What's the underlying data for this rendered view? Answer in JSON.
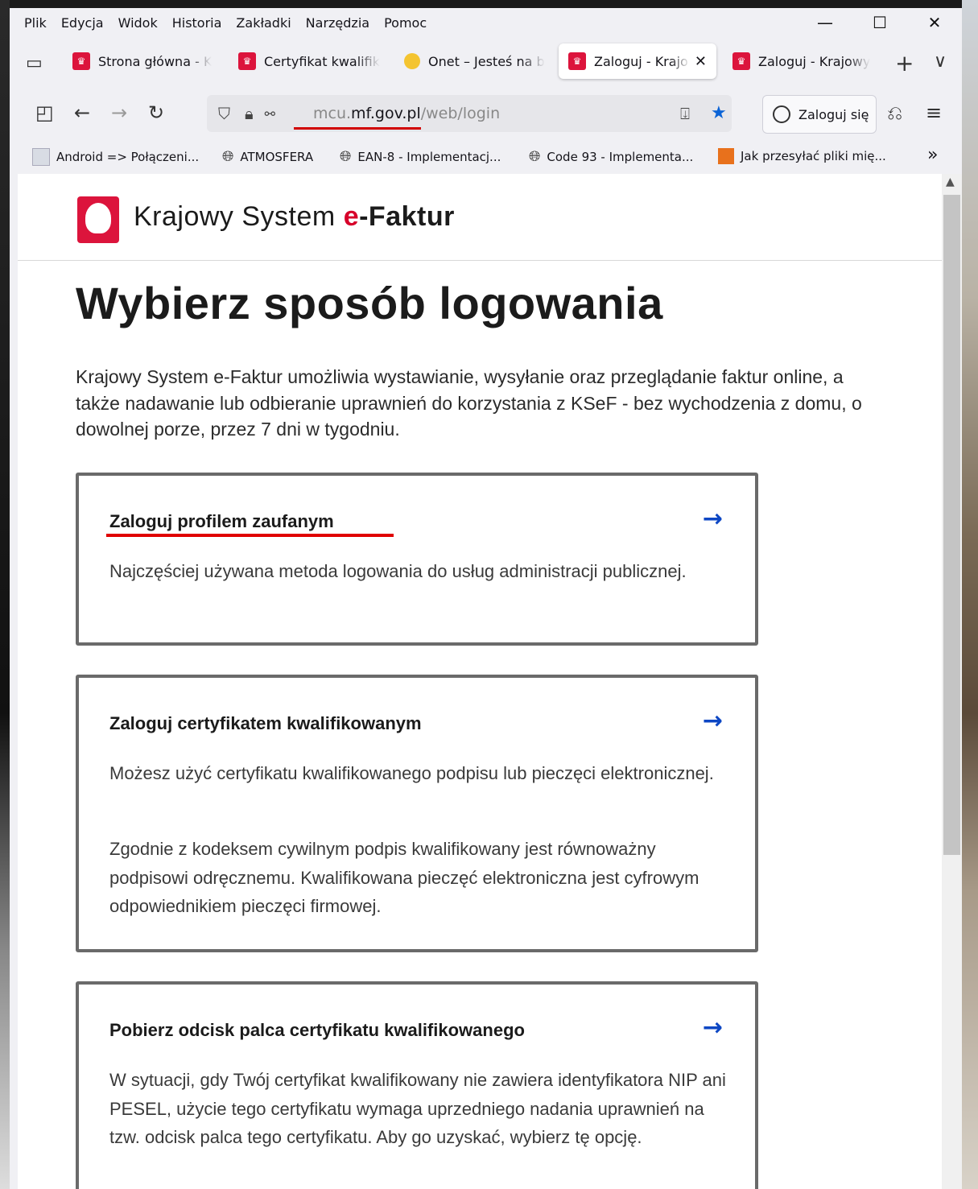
{
  "menu": [
    "Plik",
    "Edycja",
    "Widok",
    "Historia",
    "Zakładki",
    "Narzędzia",
    "Pomoc"
  ],
  "window_controls": {
    "minimize": "—",
    "maximize": "☐",
    "close": "✕"
  },
  "tabs": [
    {
      "label": "Strona główna - K",
      "favicon": "eagle-favicon"
    },
    {
      "label": "Certyfikat kwalifik",
      "favicon": "eagle-favicon"
    },
    {
      "label": "Onet – Jesteś na b",
      "favicon": "onet-favicon"
    },
    {
      "label": "Zaloguj - Krajo",
      "favicon": "eagle-favicon",
      "active": true
    },
    {
      "label": "Zaloguj - Krajowy",
      "favicon": "eagle-favicon"
    }
  ],
  "tab_close": "✕",
  "new_tab": "+",
  "tab_list": "∨",
  "url": {
    "prefix": "mcu.",
    "domain": "mf.gov.pl",
    "path": "/web/login"
  },
  "signin_label": "Zaloguj się",
  "bookmarks": [
    {
      "label": "Android => Połączeni...",
      "icon": "page-icon"
    },
    {
      "label": "ATMOSFERA",
      "icon": "globe-icon"
    },
    {
      "label": "EAN-8 - Implementacj...",
      "icon": "globe-icon"
    },
    {
      "label": "Code 93 - Implementa...",
      "icon": "globe-icon"
    },
    {
      "label": "Jak przesyłać pliki mię...",
      "icon": "stackoverflow-icon"
    }
  ],
  "bookmarks_more": "»",
  "site": {
    "title_a": "Krajowy System ",
    "title_e": "e",
    "title_b": "-Faktur"
  },
  "heading": "Wybierz sposób logowania",
  "intro": "Krajowy System e-Faktur umożliwia wystawianie, wysyłanie oraz przeglądanie faktur online, a także nadawanie lub odbieranie uprawnień do korzystania z KSeF - bez wychodzenia z domu, o dowolnej porze, przez 7 dni w tygodniu.",
  "cards": [
    {
      "title": "Zaloguj profilem zaufanym",
      "p1": "Najczęściej używana metoda logowania do usług administracji publicznej."
    },
    {
      "title": "Zaloguj certyfikatem kwalifikowanym",
      "p1": "Możesz użyć certyfikatu kwalifikowanego podpisu lub pieczęci elektronicznej.",
      "p2": "Zgodnie z kodeksem cywilnym podpis kwalifikowany jest równoważny podpisowi odręcznemu. Kwalifikowana pieczęć elektroniczna jest cyfrowym odpowiednikiem pieczęci firmowej."
    },
    {
      "title": "Pobierz odcisk palca certyfikatu kwalifikowanego",
      "p1": "W sytuacji, gdy Twój certyfikat kwalifikowany nie zawiera identyfikatora NIP ani PESEL, użycie tego certyfikatu wymaga uprzedniego nadania uprawnień na tzw. odcisk palca tego certyfikatu. Aby go uzyskać, wybierz tę opcję."
    }
  ],
  "arrow": "→",
  "colors": {
    "accent": "#0d47c4",
    "brand_red": "#dc143c",
    "annotation_red": "#e00000"
  }
}
